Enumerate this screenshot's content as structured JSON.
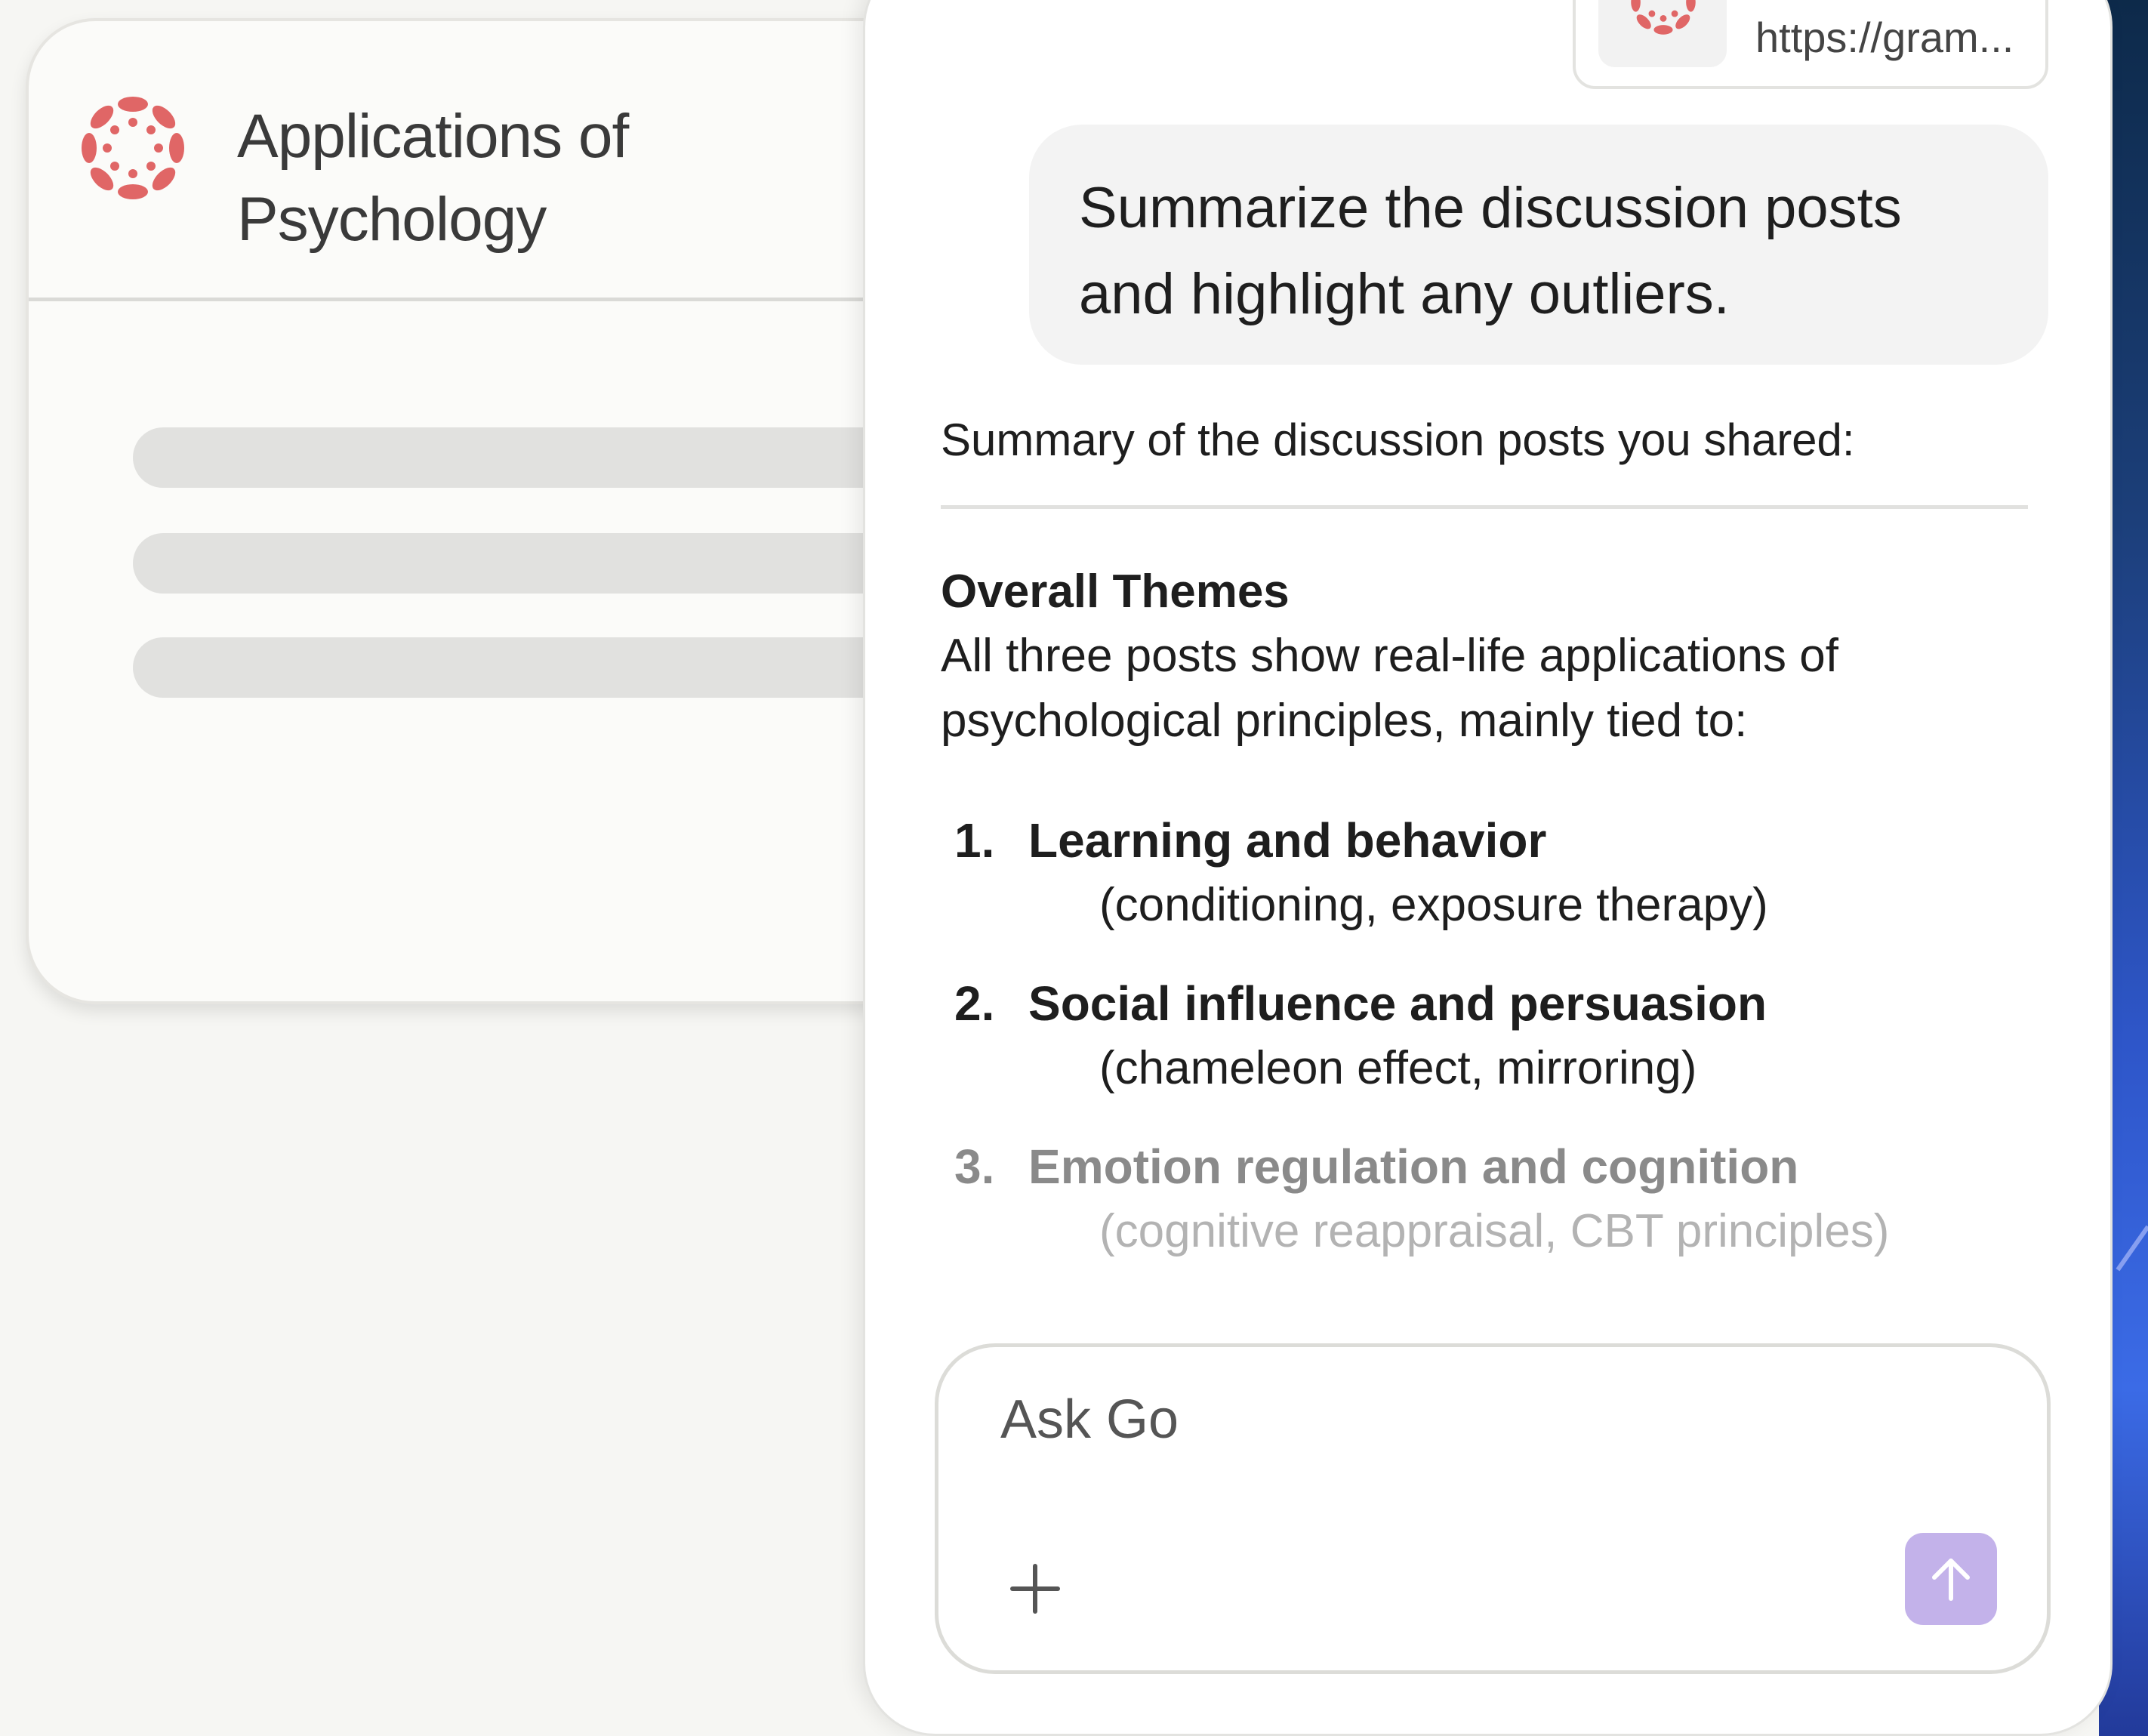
{
  "course": {
    "title": "Applications of\nPsychology",
    "logo_icon": "canvas-logo-icon",
    "accent_color": "#e06666"
  },
  "chat": {
    "link_chip": {
      "icon": "canvas-logo-icon",
      "url": "https://gram..."
    },
    "user_message": "Summarize the discussion posts and highlight any outliers.",
    "assistant": {
      "intro": "Summary of the discussion posts you shared:",
      "themes_heading": "Overall Themes",
      "themes_body": "All three posts show real-life applications of psychological principles, mainly tied to:",
      "themes": [
        {
          "number": "1.",
          "title": "Learning and behavior",
          "detail": "(conditioning, exposure therapy)"
        },
        {
          "number": "2.",
          "title": "Social influence and persuasion",
          "detail": "(chameleon effect, mirroring)"
        },
        {
          "number": "3.",
          "title": "Emotion regulation and cognition",
          "detail": "(cognitive reappraisal, CBT principles)"
        }
      ]
    },
    "composer": {
      "placeholder": "Ask Go",
      "add_icon": "plus-icon",
      "send_icon": "arrow-up-icon",
      "send_color": "#c3b2ea"
    }
  }
}
